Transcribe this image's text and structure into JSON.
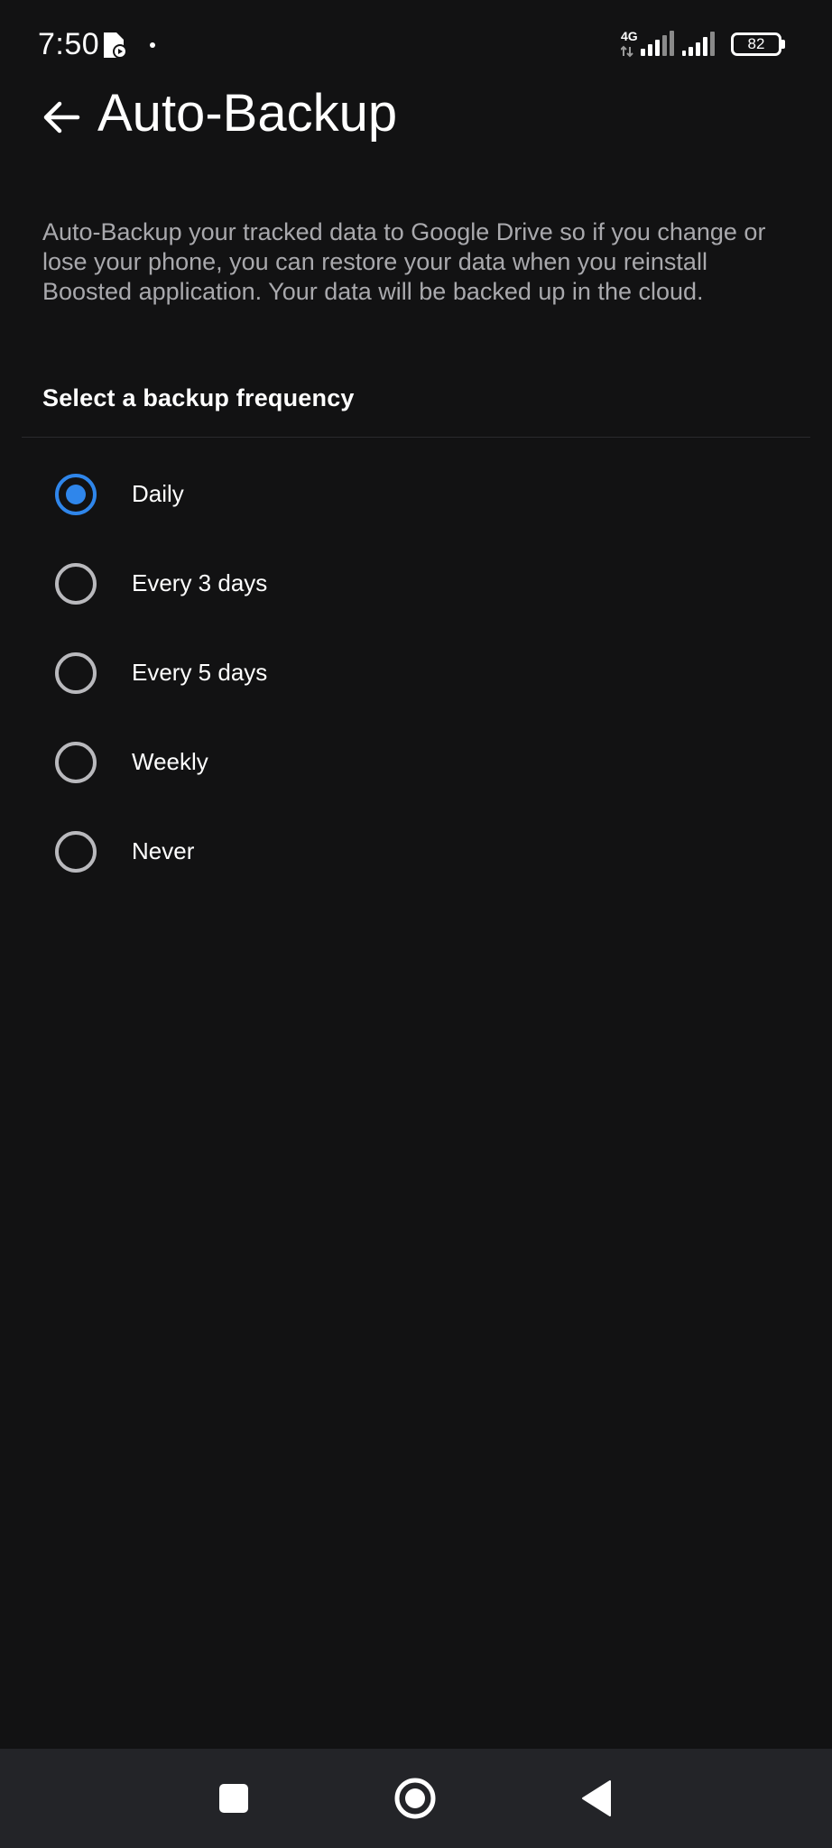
{
  "status_bar": {
    "time": "7:50",
    "network_type": "4G",
    "battery_level": "82",
    "icons": [
      "app-notification-icon",
      "dot-icon",
      "signal-icon",
      "signal-icon",
      "battery-icon"
    ]
  },
  "header": {
    "title": "Auto-Backup",
    "back_icon": "arrow-left-icon"
  },
  "description": "Auto-Backup your tracked data to Google Drive so if you change or lose your phone, you can restore your data when you reinstall Boosted application. Your data will be backed up in the cloud.",
  "frequency": {
    "section_title": "Select a backup frequency",
    "options": [
      {
        "label": "Daily",
        "selected": true
      },
      {
        "label": "Every 3 days",
        "selected": false
      },
      {
        "label": "Every 5 days",
        "selected": false
      },
      {
        "label": "Weekly",
        "selected": false
      },
      {
        "label": "Never",
        "selected": false
      }
    ]
  },
  "nav_bar": {
    "buttons": [
      "recents-square-icon",
      "home-circle-icon",
      "back-triangle-icon"
    ]
  },
  "colors": {
    "background": "#121213",
    "accent": "#2f86eb",
    "secondary_text": "#a9a9ad",
    "nav_background": "#232428"
  }
}
